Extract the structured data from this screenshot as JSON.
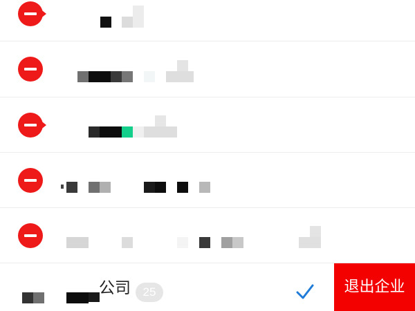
{
  "members": [
    {
      "name": "",
      "removable": true
    },
    {
      "name": "",
      "removable": true
    },
    {
      "name": "",
      "removable": true
    },
    {
      "name": "",
      "removable": true
    },
    {
      "name": "",
      "removable": true
    }
  ],
  "company": {
    "name_suffix": "公司",
    "member_count": "25"
  },
  "actions": {
    "exit_label": "退出企业"
  },
  "icons": {
    "remove": "remove-circle-icon",
    "confirm": "checkmark-icon"
  },
  "colors": {
    "danger": "#ee1a1a",
    "exit_button": "#f30000",
    "accent": "#1f7bd8",
    "divider": "#ececec",
    "badge_bg": "#e6e6e6"
  }
}
